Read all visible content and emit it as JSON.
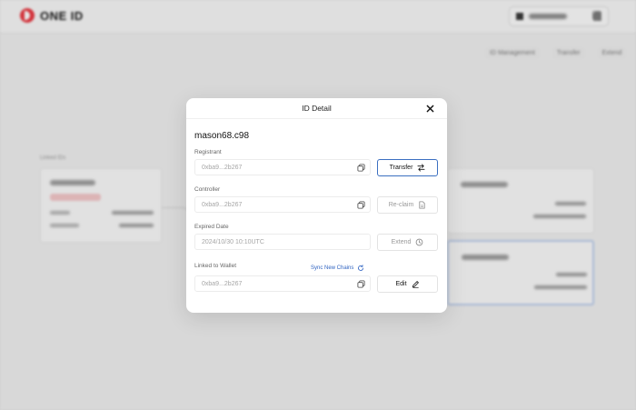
{
  "app": {
    "logo_text": "ONE ID"
  },
  "background": {
    "actions": [
      "ID Management",
      "Transfer",
      "Extend"
    ],
    "section_label": "Linked IDs"
  },
  "modal": {
    "title": "ID Detail",
    "id_name": "mason68.c98",
    "fields": {
      "registrant": {
        "label": "Registrant",
        "value": "0xba9...2b267"
      },
      "controller": {
        "label": "Controller",
        "value": "0xba9...2b267"
      },
      "expired": {
        "label": "Expired Date",
        "value": "2024/10/30 10:10UTC"
      },
      "linked": {
        "label": "Linked to Wallet",
        "value": "0xba9...2b267"
      }
    },
    "sync_label": "Sync New Chains",
    "buttons": {
      "transfer": "Transfer",
      "reclaim": "Re-claim",
      "extend": "Extend",
      "edit": "Edit"
    }
  },
  "colors": {
    "brand_red": "#e8323b",
    "link_blue": "#2f63c1",
    "primary_border": "#3b6fc1"
  }
}
